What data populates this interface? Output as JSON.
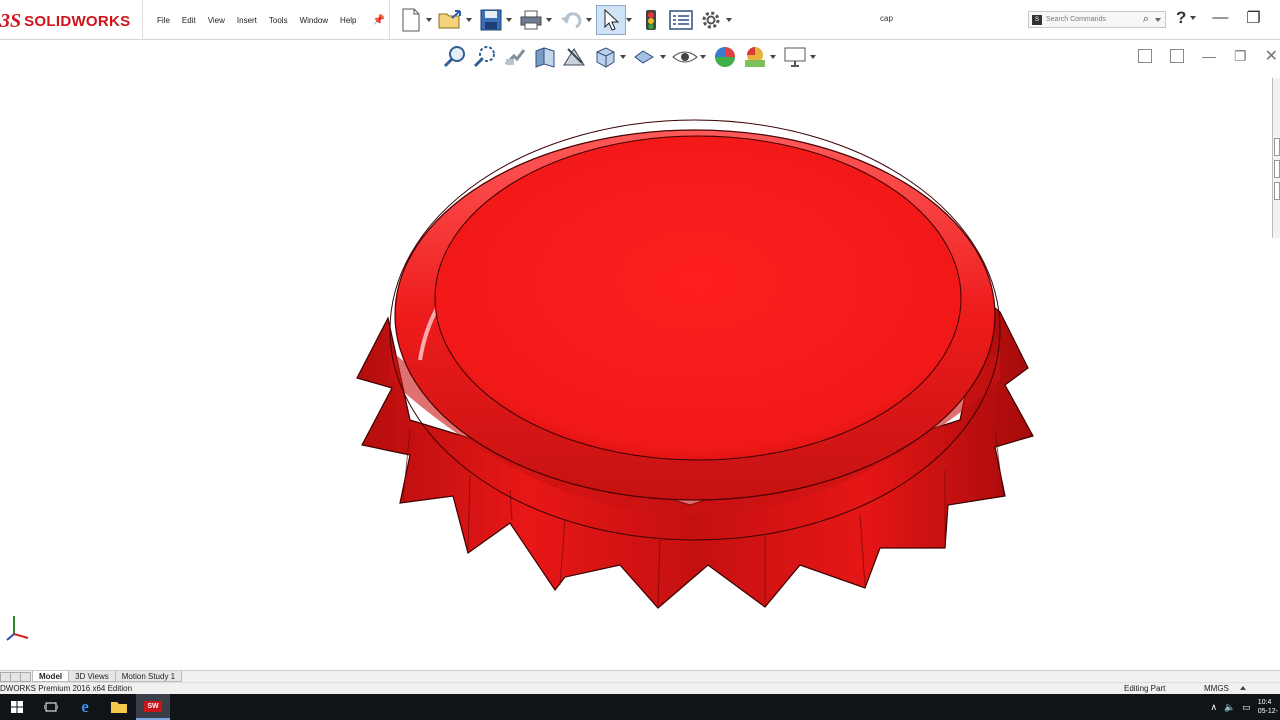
{
  "app": {
    "brand": "SOLIDWORKS",
    "ds_mark": "3S",
    "document_title": "cap"
  },
  "menu": {
    "items": [
      "File",
      "Edit",
      "View",
      "Insert",
      "Tools",
      "Window",
      "Help"
    ]
  },
  "search": {
    "placeholder": "Search Commands",
    "prefix_icon_text": "S"
  },
  "tabs": [
    {
      "label": "Model",
      "active": true
    },
    {
      "label": "3D Views",
      "active": false
    },
    {
      "label": "Motion Study 1",
      "active": false
    }
  ],
  "status": {
    "edition": "DWORKS Premium 2016 x64 Edition",
    "mode": "Editing Part",
    "units": "MMGS"
  },
  "taskbar": {
    "clock_time": "10:4",
    "clock_date": "05-12-",
    "app_badge": "SW"
  },
  "colors": {
    "accent": "#d0121b",
    "part": "#ee1c1c",
    "selected_tool": "#cfe3f7"
  },
  "icons": {
    "toolbar": [
      "new-document-icon",
      "open-icon",
      "save-icon",
      "print-icon",
      "undo-icon",
      "select-icon",
      "rebuild-icon",
      "file-properties-icon",
      "options-icon"
    ],
    "view": [
      "zoom-to-fit-icon",
      "zoom-to-area-icon",
      "previous-view-icon",
      "section-view-icon",
      "dynamic-annotation-icon",
      "view-orientation-icon",
      "display-style-icon",
      "hide-show-icon",
      "edit-appearance-icon",
      "apply-scene-icon",
      "view-settings-icon"
    ]
  }
}
